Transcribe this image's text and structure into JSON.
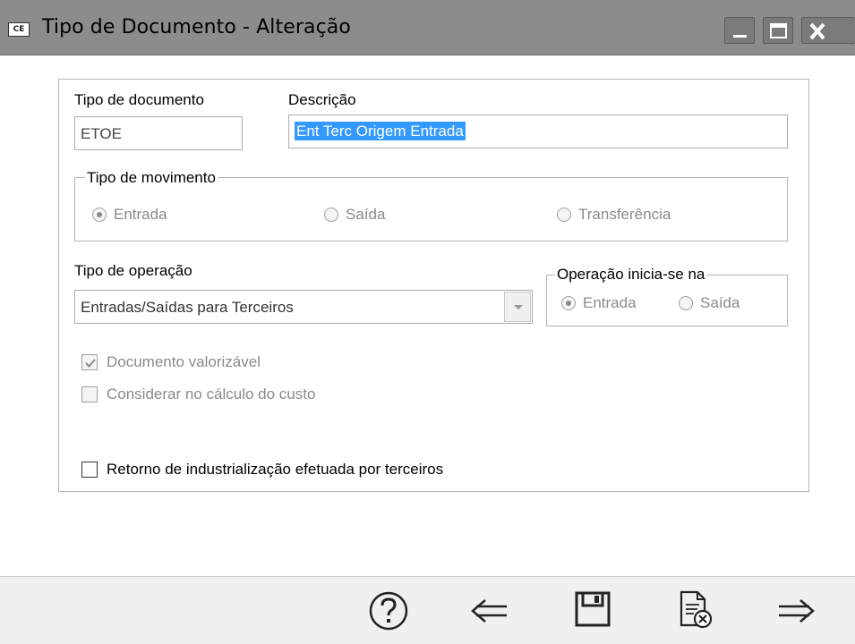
{
  "window": {
    "app_icon_text": "CE",
    "title": "Tipo de Documento - Alteração"
  },
  "form": {
    "tipo_documento": {
      "label": "Tipo de documento",
      "value": "ETOE"
    },
    "descricao": {
      "label": "Descrição",
      "value": "Ent Terc Origem Entrada"
    },
    "tipo_movimento": {
      "title": "Tipo de movimento",
      "options": [
        "Entrada",
        "Saída",
        "Transferência"
      ],
      "selected": "Entrada"
    },
    "tipo_operacao": {
      "label": "Tipo de operação",
      "value": "Entradas/Saídas para Terceiros"
    },
    "operacao_inicia": {
      "title": "Operação inicia-se na",
      "options": [
        "Entrada",
        "Saída"
      ],
      "selected": "Entrada"
    },
    "checkboxes": {
      "documento_valorizavel": {
        "label": "Documento valorizável",
        "checked": true
      },
      "considerar_custo": {
        "label": "Considerar no cálculo do custo",
        "checked": false
      },
      "retorno_industrializacao": {
        "label": "Retorno de industrialização efetuada por terceiros",
        "checked": false
      }
    }
  },
  "toolbar": {
    "icons": [
      "help-icon",
      "back-arrow-icon",
      "save-icon",
      "cancel-document-icon",
      "forward-arrow-icon"
    ]
  }
}
